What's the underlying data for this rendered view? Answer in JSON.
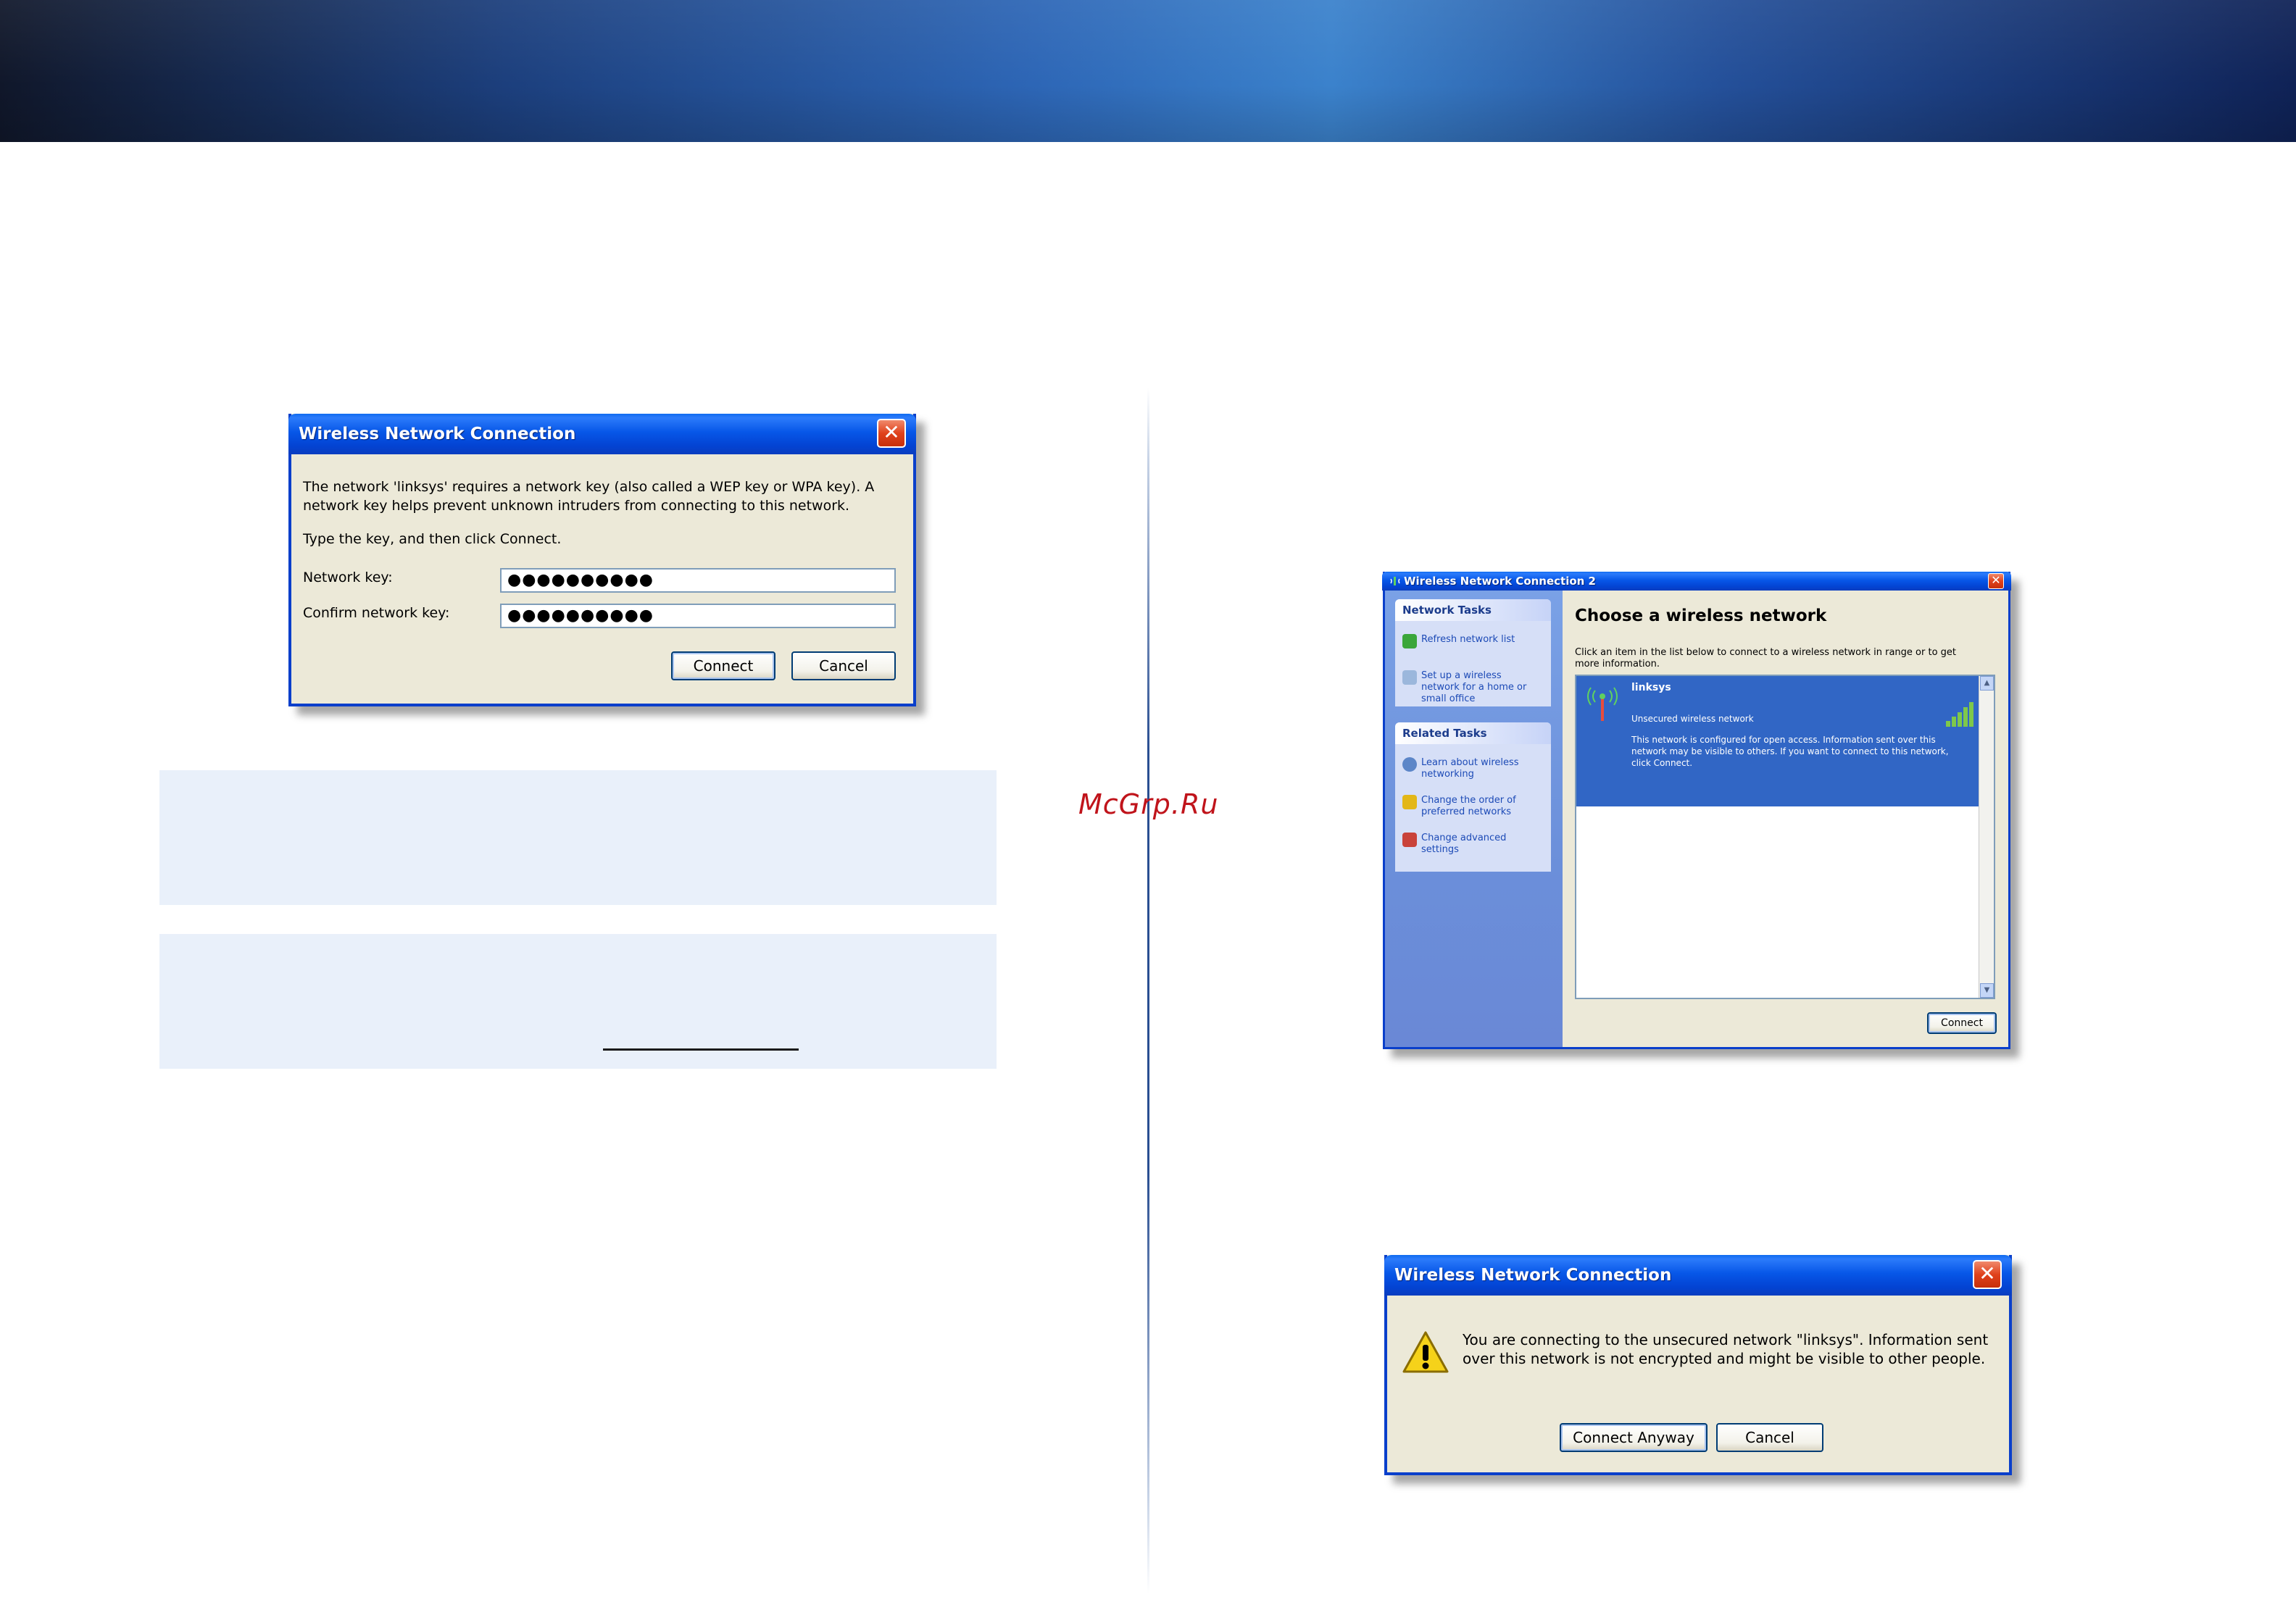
{
  "watermark": "McGrp.Ru",
  "dialog1": {
    "title": "Wireless Network Connection",
    "close_glyph": "✕",
    "message_line1": "The network 'linksys' requires a network key (also called a WEP key or WPA key). A",
    "message_line2": "network key helps prevent unknown intruders from connecting to this network.",
    "instruction": "Type the key, and then click Connect.",
    "network_key_label": "Network key:",
    "network_key_value": "●●●●●●●●●●",
    "confirm_key_label": "Confirm network key:",
    "confirm_key_value": "●●●●●●●●●●",
    "connect_label": "Connect",
    "cancel_label": "Cancel"
  },
  "dialog2": {
    "title": "Wireless Network Connection 2",
    "close_glyph": "✕",
    "network_tasks_header": "Network Tasks",
    "network_tasks": [
      {
        "label": "Refresh network list",
        "icon": "refresh-icon"
      },
      {
        "label": "Set up a wireless network for a home or small office",
        "icon": "setup-wireless-icon"
      }
    ],
    "related_tasks_header": "Related Tasks",
    "related_tasks": [
      {
        "label": "Learn about wireless networking",
        "icon": "help-icon"
      },
      {
        "label": "Change the order of preferred networks",
        "icon": "star-icon"
      },
      {
        "label": "Change advanced settings",
        "icon": "settings-icon"
      }
    ],
    "heading": "Choose a wireless network",
    "subtext": "Click an item in the list below to connect to a wireless network in range or to get more information.",
    "network": {
      "name": "linksys",
      "security": "Unsecured wireless network",
      "description": "This network is configured for open access. Information sent over this network may be visible to others. If you want to connect to this network, click Connect."
    },
    "connect_label": "Connect"
  },
  "dialog3": {
    "title": "Wireless Network Connection",
    "close_glyph": "✕",
    "message_line1": "You are connecting to the unsecured network \"linksys\". Information sent",
    "message_line2": "over this network is not encrypted and might be visible to other people.",
    "connect_anyway_label": "Connect Anyway",
    "cancel_label": "Cancel"
  }
}
